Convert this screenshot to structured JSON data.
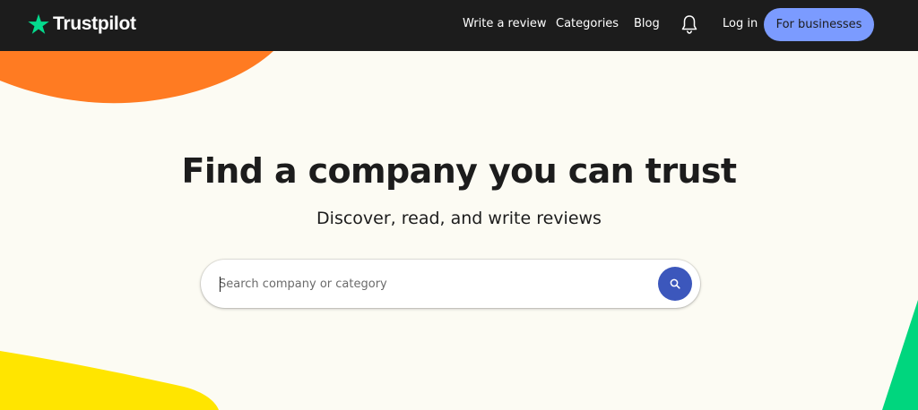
{
  "header": {
    "logo_text": "Trustpilot",
    "nav": {
      "write_review": "Write a review",
      "categories": "Categories",
      "blog": "Blog",
      "login": "Log in",
      "for_businesses": "For businesses"
    },
    "icons": {
      "logo": "star-icon",
      "notifications": "bell-icon"
    }
  },
  "hero": {
    "title": "Find a company you can trust",
    "subtitle": "Discover, read, and write reviews"
  },
  "search": {
    "placeholder": "Search company or category",
    "value": "",
    "button_icon": "search-icon"
  },
  "colors": {
    "header_bg": "#1c1c1c",
    "page_bg": "#fcfbf3",
    "brand_green": "#04da8d",
    "business_button": "#7b9bff",
    "search_button": "#3c57bc",
    "orange_shape": "#ff7b22",
    "yellow_shape": "#ffe500",
    "green_shape": "#00d67e"
  }
}
